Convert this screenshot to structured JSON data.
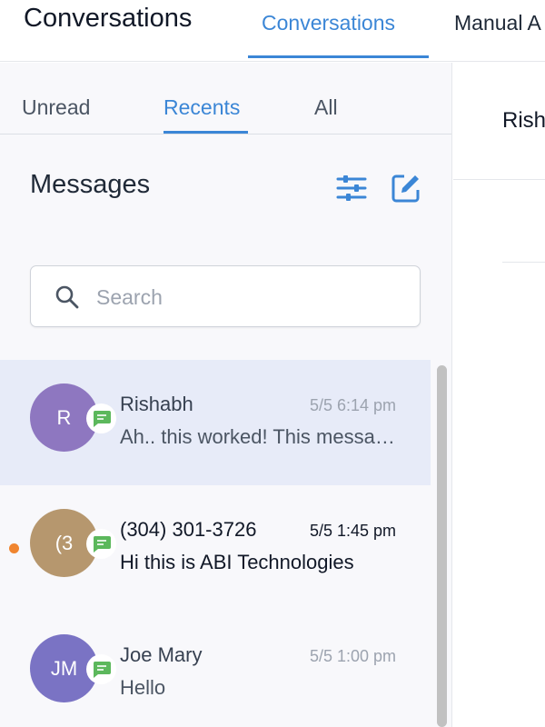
{
  "header": {
    "app_title": "Conversations",
    "tabs": [
      {
        "label": "Conversations",
        "active": true
      },
      {
        "label": "Manual A",
        "active": false
      }
    ]
  },
  "left_pane": {
    "subtabs": [
      {
        "label": "Unread",
        "active": false
      },
      {
        "label": "Recents",
        "active": true
      },
      {
        "label": "All",
        "active": false
      }
    ],
    "title": "Messages",
    "icons": {
      "filter": "filter-sliders-icon",
      "compose": "compose-edit-icon"
    },
    "search": {
      "placeholder": "Search",
      "value": ""
    }
  },
  "conversations": [
    {
      "initials": "R",
      "name": "Rishabh",
      "time": "5/5 6:14 pm",
      "preview": "Ah.. this worked! This message has been sent",
      "avatar_color": "#8e77c0",
      "unread": false,
      "selected": true,
      "channel_icon": "sms-message-icon"
    },
    {
      "initials": "(3",
      "name": "(304) 301-3726",
      "time": "5/5 1:45 pm",
      "preview": "Hi this is ABI Technologies",
      "avatar_color": "#b6976e",
      "unread": true,
      "selected": false,
      "channel_icon": "sms-message-icon"
    },
    {
      "initials": "JM",
      "name": "Joe Mary",
      "time": "5/5 1:00 pm",
      "preview": "Hello",
      "avatar_color": "#7a73c4",
      "unread": false,
      "selected": false,
      "channel_icon": "sms-message-icon"
    }
  ],
  "right_pane": {
    "contact_name": "Rish"
  },
  "colors": {
    "accent": "#3b86d6",
    "channel_badge": "#5cb85c",
    "unread_dot": "#f0852f",
    "selected_row": "#e7ebf8"
  }
}
